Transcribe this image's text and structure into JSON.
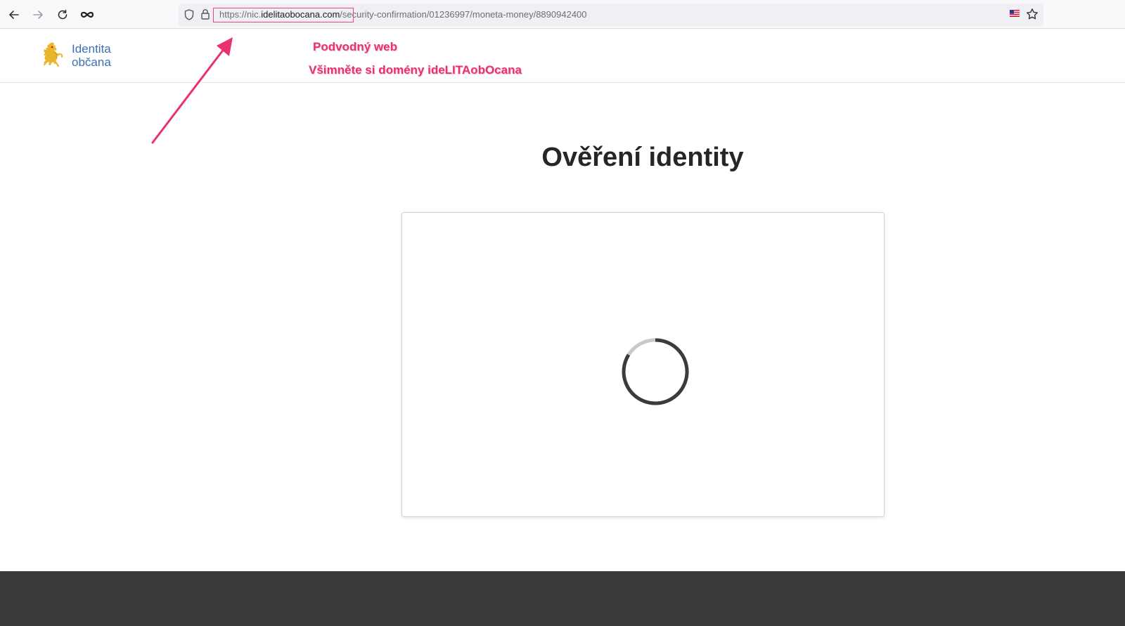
{
  "browser": {
    "url_prefix": "https://nic.",
    "url_domain": "idelitaobocana.com",
    "url_path": "/security-confirmation/01236997/moneta-money/8890942400"
  },
  "header": {
    "logo_line1": "Identita",
    "logo_line2": "občana"
  },
  "annotations": {
    "label1": "Podvodný web",
    "label2": "Všimněte si domény ideLITAobOcana"
  },
  "main": {
    "title": "Ověření identity"
  },
  "colors": {
    "annotation": "#e8326e",
    "logo_text": "#3c6fb2",
    "logo_lion": "#e9b62b",
    "footer": "#3a3a3a"
  },
  "icons": {
    "back": "arrow-left",
    "forward": "arrow-right",
    "reload": "reload",
    "extension": "infinity",
    "shield": "shield",
    "lock": "padlock",
    "flag": "us-flag",
    "bookmark": "star",
    "logo": "heraldic-lion",
    "loading": "spinner"
  }
}
